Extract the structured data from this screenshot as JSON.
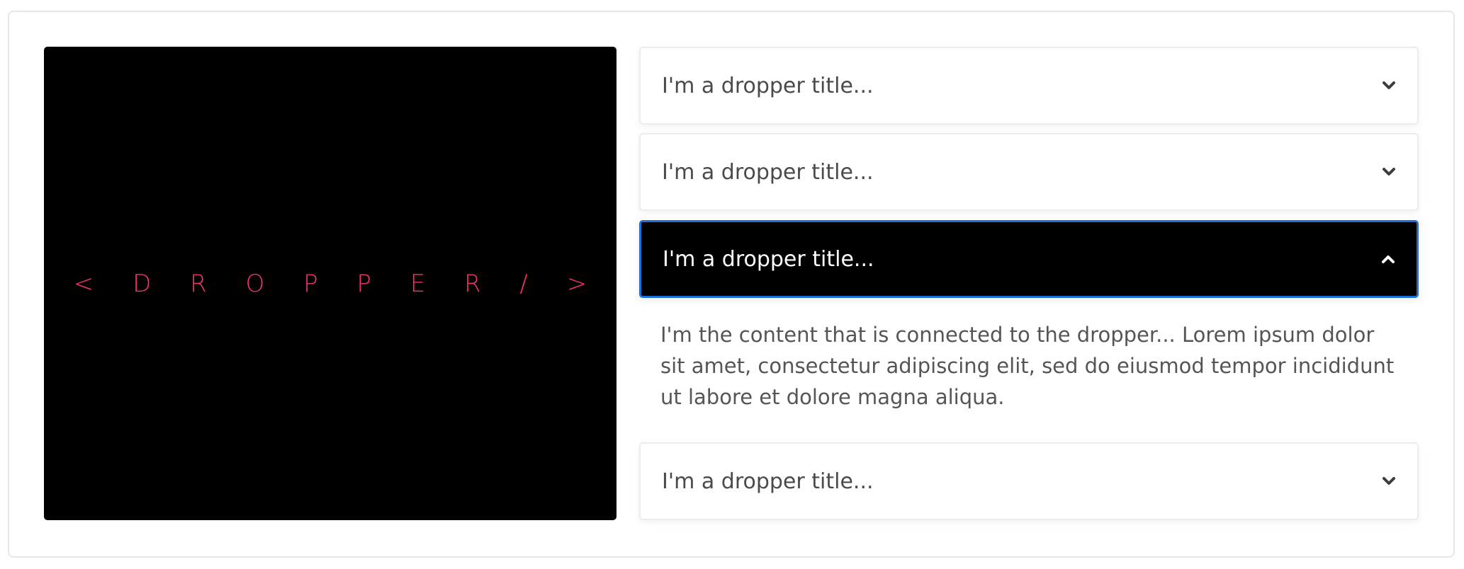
{
  "hero": {
    "logo_text": "< D R O P P E R / >"
  },
  "accordion": {
    "items": [
      {
        "title": "I'm a dropper title...",
        "expanded": false,
        "icon": "chevron-down-icon"
      },
      {
        "title": "I'm a dropper title...",
        "expanded": false,
        "icon": "chevron-down-icon"
      },
      {
        "title": "I'm a dropper title...",
        "expanded": true,
        "icon": "chevron-up-icon",
        "content": "I'm the content that is connected to the dropper... Lorem ipsum dolor sit amet, consectetur adipiscing elit, sed do eiusmod tempor incididunt ut labore et dolore magna aliqua."
      },
      {
        "title": "I'm a dropper title...",
        "expanded": false,
        "icon": "chevron-down-icon"
      }
    ]
  },
  "colors": {
    "hero_background": "#000000",
    "logo_accent": "#f0346f",
    "active_border": "#1e6fd9",
    "active_background": "#000000"
  }
}
